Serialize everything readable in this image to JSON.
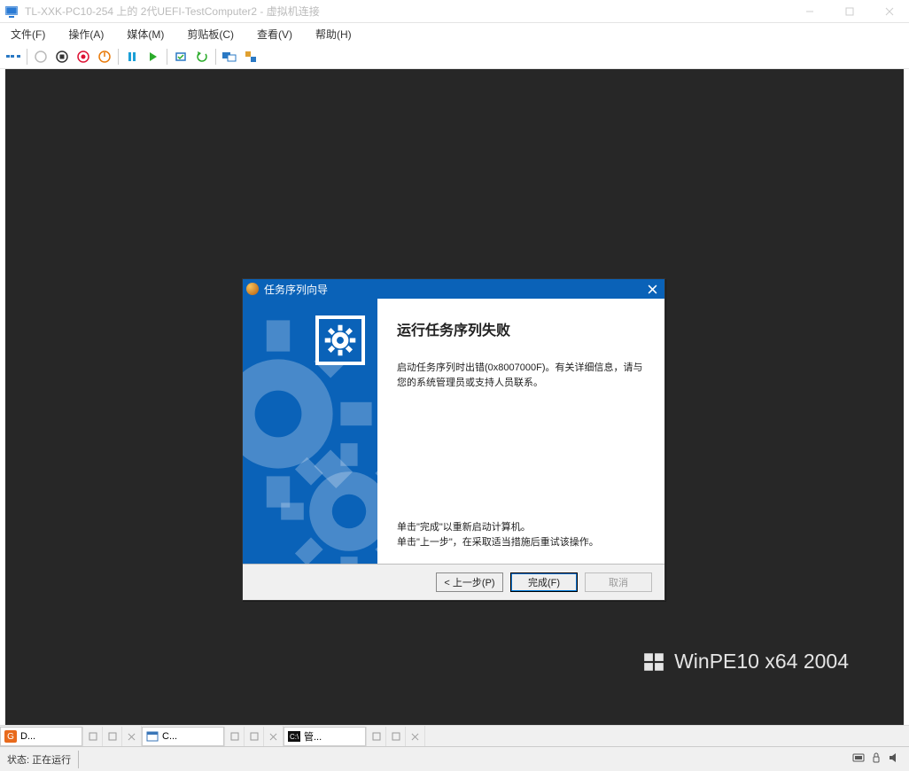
{
  "titlebar": {
    "text": "TL-XXK-PC10-254 上的 2代UEFI-TestComputer2 - 虚拟机连接"
  },
  "menu": {
    "file": "文件(F)",
    "action": "操作(A)",
    "media": "媒体(M)",
    "clipboard": "剪贴板(C)",
    "view": "查看(V)",
    "help": "帮助(H)"
  },
  "watermark": {
    "text": "WinPE10 x64 2004"
  },
  "wizard": {
    "title": "任务序列向导",
    "heading": "运行任务序列失败",
    "message_line1": "启动任务序列时出错(0x8007000F)。有关详细信息，请与",
    "message_line2": "您的系统管理员或支持人员联系。",
    "hint_line1": "单击\"完成\"以重新启动计算机。",
    "hint_line2": "单击\"上一步\"，在采取适当措施后重试该操作。",
    "btn_back": "< 上一步(P)",
    "btn_finish": "完成(F)",
    "btn_cancel": "取消"
  },
  "taskbar": {
    "t1_label": "D...",
    "t2_label": "C...",
    "t3_label": "管..."
  },
  "status": {
    "label": "状态: 正在运行"
  }
}
